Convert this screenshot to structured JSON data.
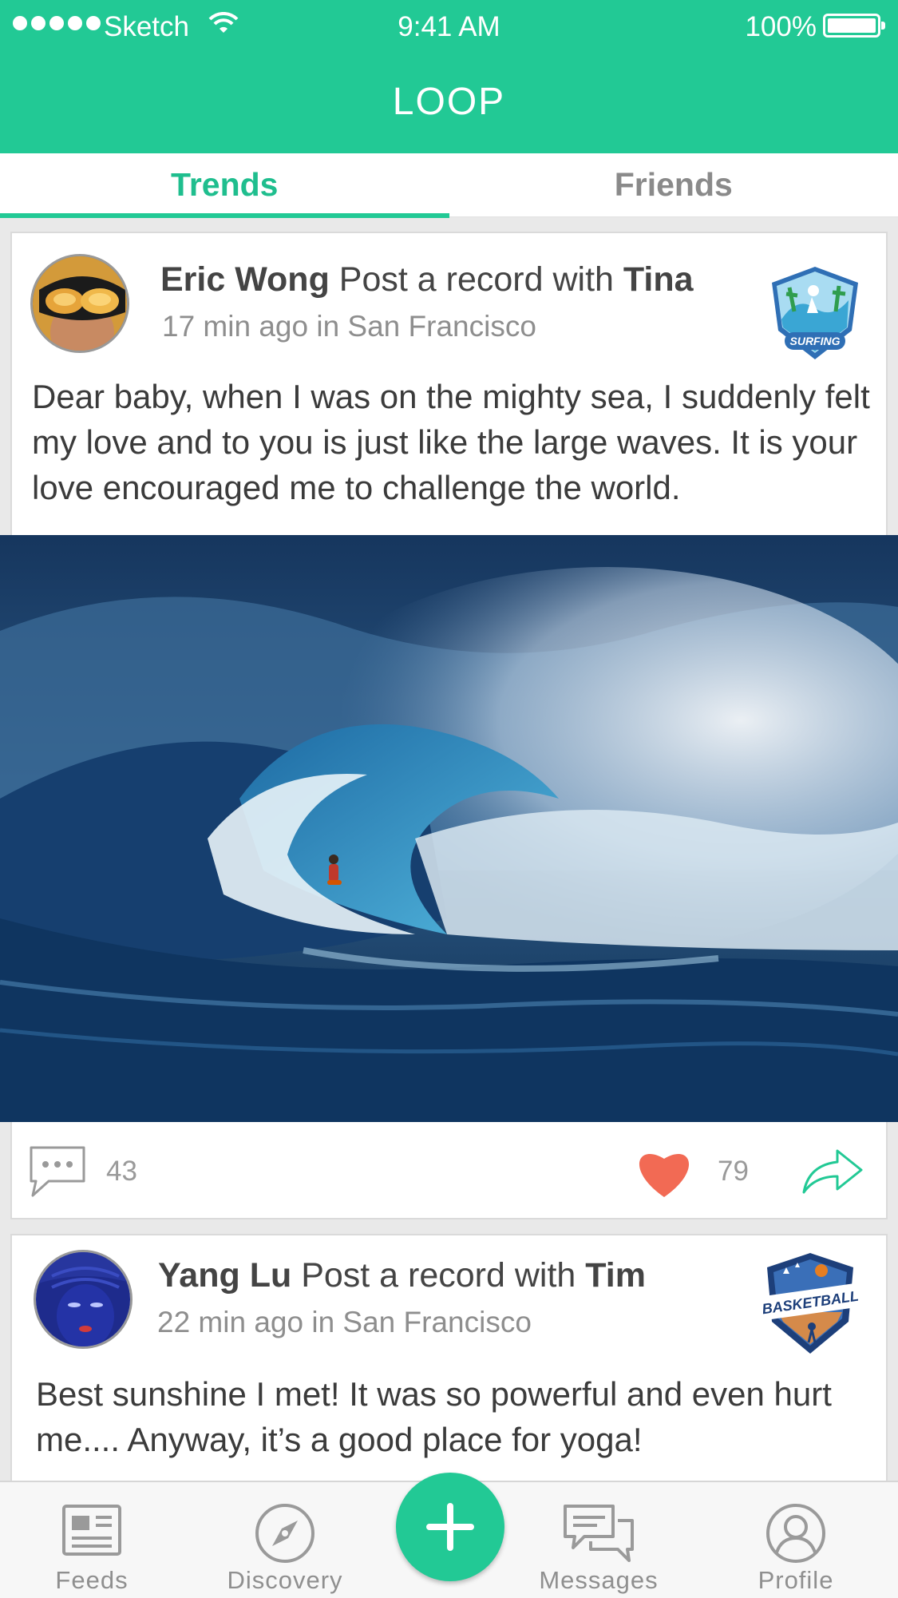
{
  "status_bar": {
    "carrier": "Sketch",
    "time": "9:41 AM",
    "battery": "100%"
  },
  "header": {
    "title": "LOOP"
  },
  "tabs": [
    {
      "label": "Trends",
      "active": true
    },
    {
      "label": "Friends",
      "active": false
    }
  ],
  "posts": [
    {
      "author": "Eric Wong",
      "action": "Post a record with",
      "partner": "Tina",
      "meta": "17 min ago in San Francisco",
      "badge_icon": "surfing-badge-icon",
      "badge_text": "SURFING",
      "text": "Dear baby, when I was on the mighty sea, I suddenly felt my love and to you is just like the large waves. It is your love encouraged me to challenge the world.",
      "comments": "43",
      "likes": "79"
    },
    {
      "author": "Yang Lu",
      "action": "Post a record with",
      "partner": "Tim",
      "meta": "22 min ago in San Francisco",
      "badge_icon": "basketball-badge-icon",
      "badge_text": "BASKETBALL",
      "text": "Best sunshine I met! It was so powerful and even hurt me.... Anyway, it’s a good place for yoga!"
    }
  ],
  "tabbar": {
    "items": [
      {
        "label": "Feeds",
        "icon": "feeds-icon"
      },
      {
        "label": "Discovery",
        "icon": "compass-icon"
      },
      {
        "label": "Messages",
        "icon": "messages-icon"
      },
      {
        "label": "Profile",
        "icon": "profile-icon"
      }
    ],
    "plus_icon": "plus-icon"
  },
  "colors": {
    "accent": "#22c995",
    "like": "#f26a54",
    "text": "#3b3b3b",
    "meta": "#8e8e8e"
  }
}
